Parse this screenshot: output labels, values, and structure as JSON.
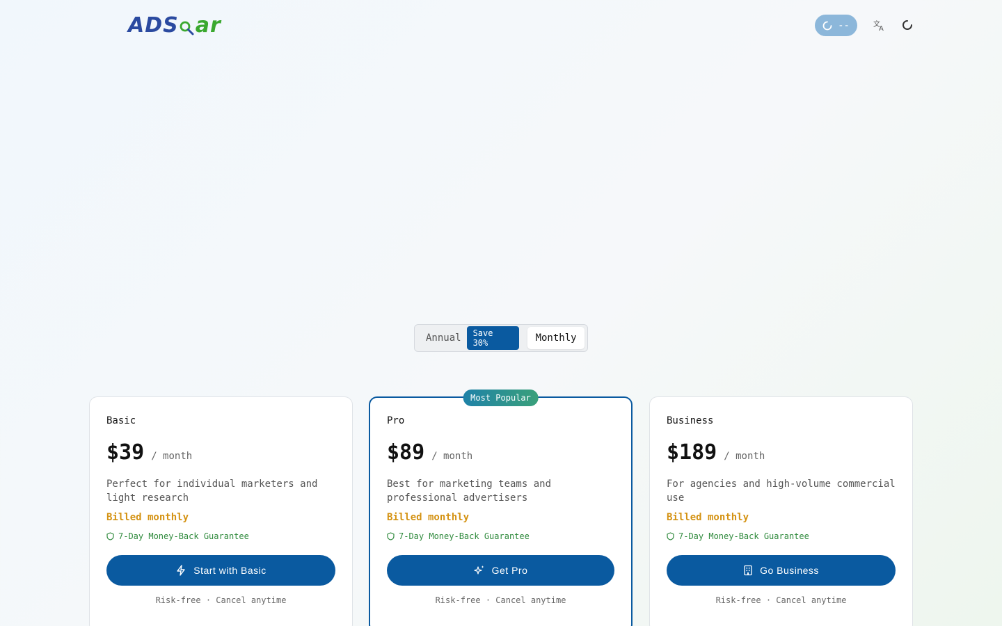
{
  "brand": {
    "logo_part1": "ADS",
    "logo_part2": "ar",
    "color_primary": "#2b4aa0",
    "color_secondary": "#3aa82f"
  },
  "header": {
    "status_pill_text": "--",
    "language_icon": "translate-icon",
    "loading_icon": "spinner-icon"
  },
  "billing_toggle": {
    "annual_label": "Annual",
    "save_badge": "Save 30%",
    "monthly_label": "Monthly",
    "selected": "Monthly"
  },
  "plans": [
    {
      "name": "Basic",
      "price": "$39",
      "period": "/ month",
      "description": "Perfect for individual marketers and light research",
      "billed": "Billed monthly",
      "guarantee": "7-Day Money-Back Guarantee",
      "cta": "Start with Basic",
      "cta_icon": "lightning-icon",
      "note": "Risk-free · Cancel anytime",
      "popular": false
    },
    {
      "name": "Pro",
      "price": "$89",
      "period": "/ month",
      "description": "Best for marketing teams and professional advertisers",
      "billed": "Billed monthly",
      "guarantee": "7-Day Money-Back Guarantee",
      "cta": "Get Pro",
      "cta_icon": "sparkles-icon",
      "note": "Risk-free · Cancel anytime",
      "popular": true,
      "badge": "Most Popular"
    },
    {
      "name": "Business",
      "price": "$189",
      "period": "/ month",
      "description": "For agencies and high-volume commercial use",
      "billed": "Billed monthly",
      "guarantee": "7-Day Money-Back Guarantee",
      "cta": "Go Business",
      "cta_icon": "building-icon",
      "note": "Risk-free · Cancel anytime",
      "popular": false
    }
  ],
  "colors": {
    "accent": "#0a5aa0",
    "billed": "#d49212",
    "guarantee": "#2f8a3c"
  }
}
